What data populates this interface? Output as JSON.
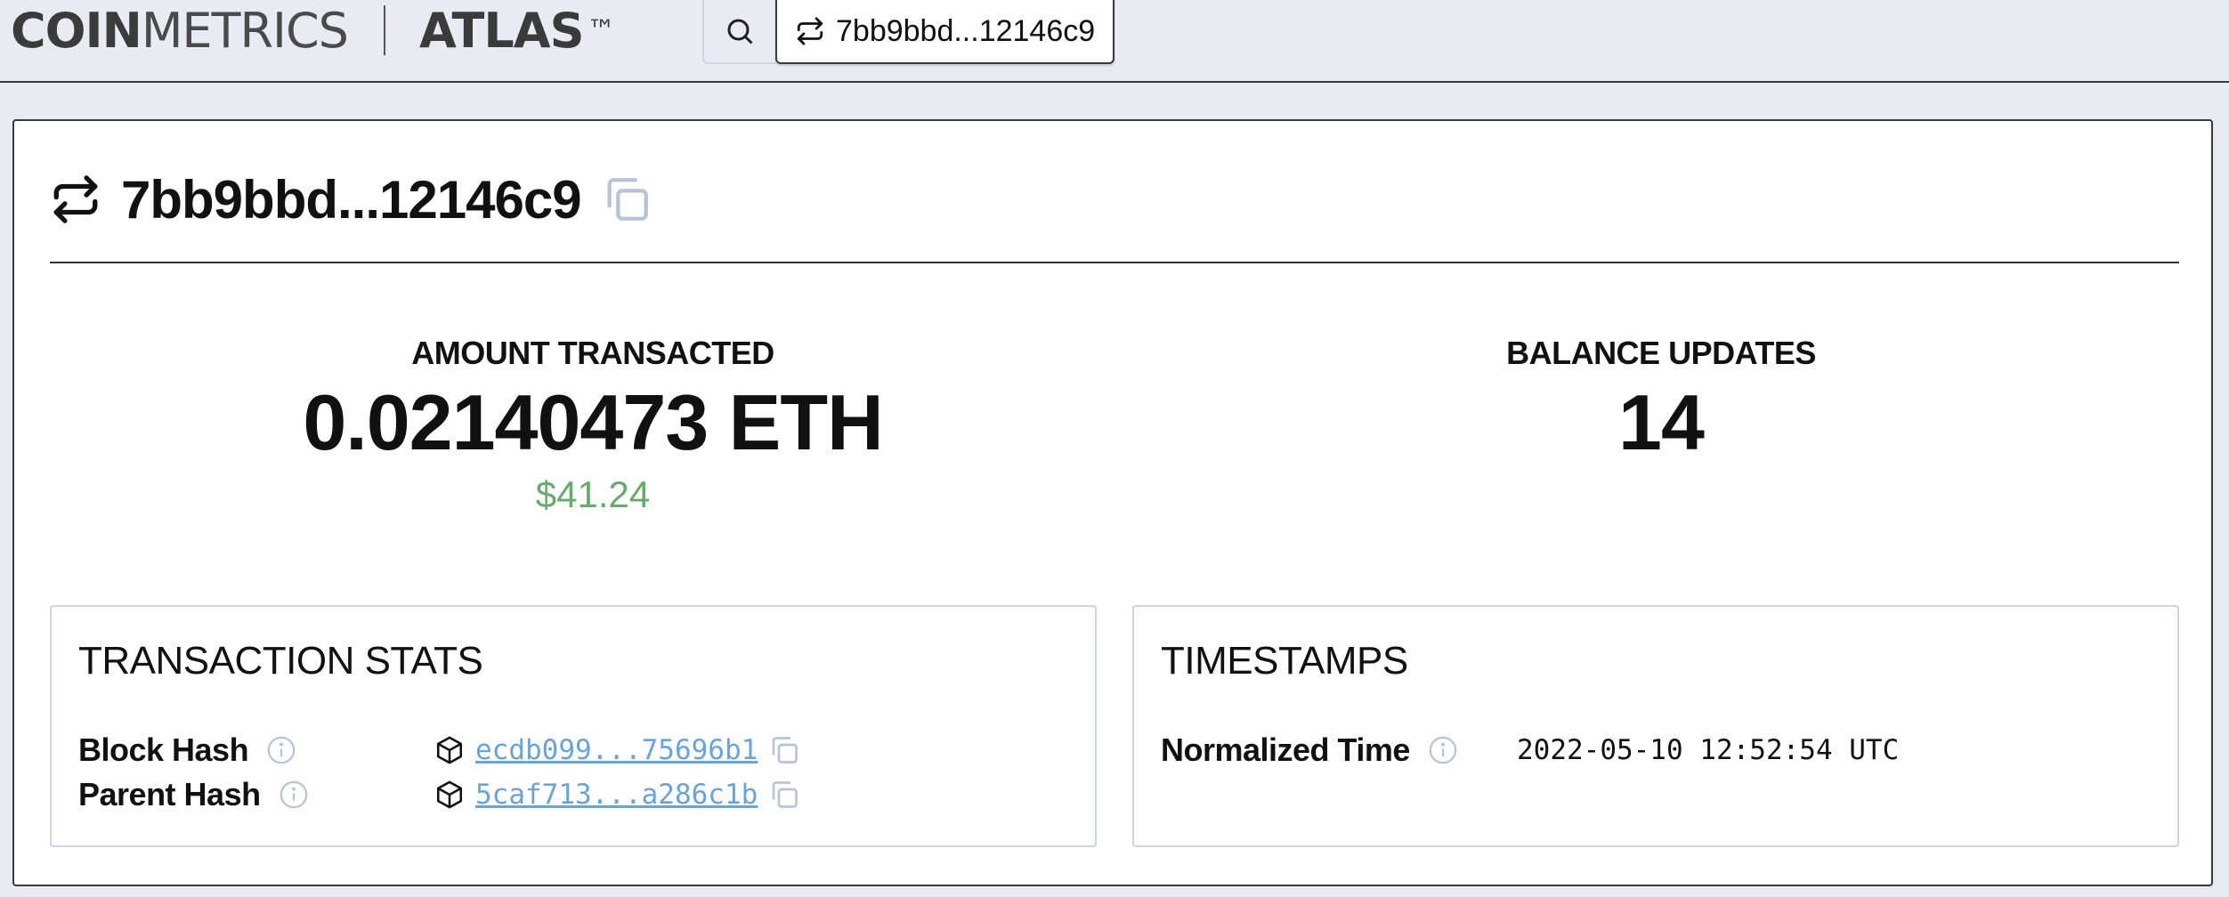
{
  "header": {
    "brand_primary": "COIN",
    "brand_secondary": "METRICS",
    "product": "ATLAS",
    "trademark": "™",
    "search_icon": "search-icon",
    "active_tab": {
      "icon": "transfer-icon",
      "label": "7bb9bbd...12146c9"
    }
  },
  "transaction": {
    "icon": "transfer-icon",
    "title": "7bb9bbd...12146c9",
    "copy_icon": "copy-icon"
  },
  "metrics": {
    "amount": {
      "label": "AMOUNT TRANSACTED",
      "value": "0.02140473 ETH",
      "usd": "$41.24"
    },
    "balance_updates": {
      "label": "BALANCE UPDATES",
      "value": "14"
    }
  },
  "stats": {
    "title": "TRANSACTION STATS",
    "rows": [
      {
        "label": "Block Hash",
        "value": "ecdb099...75696b1"
      },
      {
        "label": "Parent Hash",
        "value": "5caf713...a286c1b"
      }
    ]
  },
  "timestamps": {
    "title": "TIMESTAMPS",
    "rows": [
      {
        "label": "Normalized Time",
        "value": "2022-05-10 12:52:54 UTC"
      }
    ]
  },
  "colors": {
    "accent_link": "#6aa3d8",
    "usd_green": "#6aa86e",
    "background": "#e9ebf3"
  }
}
